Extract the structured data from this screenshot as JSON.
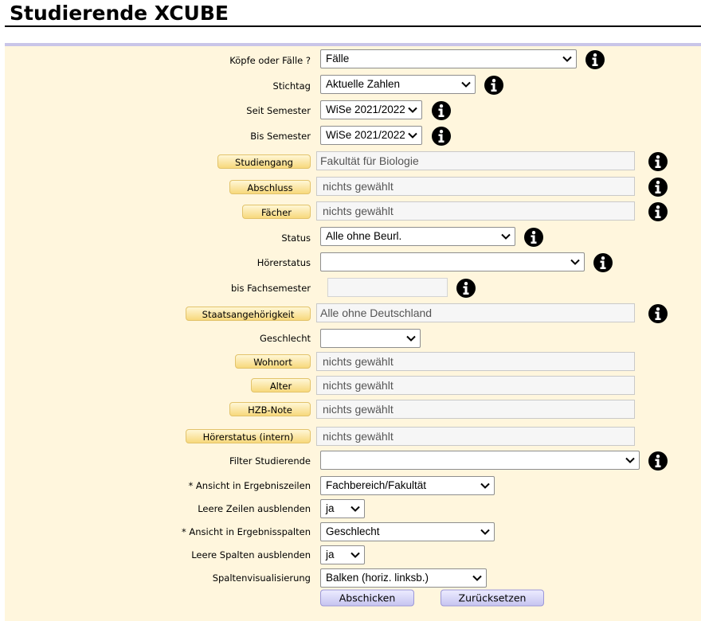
{
  "header": {
    "title": "Studierende XCUBE"
  },
  "form": {
    "koepfe": {
      "label": "Köpfe oder Fälle ?",
      "value": "Fälle"
    },
    "stichtag": {
      "label": "Stichtag",
      "value": "Aktuelle Zahlen"
    },
    "seit_semester": {
      "label": "Seit Semester",
      "value": "WiSe 2021/2022"
    },
    "bis_semester": {
      "label": "Bis Semester",
      "value": "WiSe 2021/2022"
    },
    "studiengang": {
      "button": "Studiengang",
      "value": "Fakultät für Biologie"
    },
    "abschluss": {
      "button": "Abschluss",
      "value": "nichts gewählt"
    },
    "faecher": {
      "button": "Fächer",
      "value": "nichts gewählt"
    },
    "status": {
      "label": "Status",
      "value": "Alle ohne Beurl."
    },
    "hoererstatus": {
      "label": "Hörerstatus",
      "value": ""
    },
    "bis_fachsemester": {
      "label": "bis Fachsemester",
      "value": ""
    },
    "staatsangehoerigkeit": {
      "button": "Staatsangehörigkeit",
      "value": "Alle ohne Deutschland"
    },
    "geschlecht": {
      "label": "Geschlecht",
      "value": ""
    },
    "wohnort": {
      "button": "Wohnort",
      "value": "nichts gewählt"
    },
    "alter": {
      "button": "Alter",
      "value": "nichts gewählt"
    },
    "hzb_note": {
      "button": "HZB-Note",
      "value": "nichts gewählt"
    },
    "hoererstatus_intern": {
      "button": "Hörerstatus (intern)",
      "value": "nichts gewählt"
    },
    "filter_studierende": {
      "label": "Filter Studierende",
      "value": ""
    },
    "ansicht_zeilen": {
      "label": "* Ansicht in Ergebniszeilen",
      "value": "Fachbereich/Fakultät"
    },
    "leere_zeilen": {
      "label": "Leere Zeilen ausblenden",
      "value": "ja"
    },
    "ansicht_spalten": {
      "label": "* Ansicht in Ergebnisspalten",
      "value": "Geschlecht"
    },
    "leere_spalten": {
      "label": "Leere Spalten ausblenden",
      "value": "ja"
    },
    "spaltenvisualisierung": {
      "label": "Spaltenvisualisierung",
      "value": "Balken (horiz. linksb.)"
    }
  },
  "actions": {
    "submit": "Abschicken",
    "reset": "Zurücksetzen"
  },
  "icons": {
    "info": "info-circle-icon",
    "dropdown": "chevron-down-icon"
  },
  "colors": {
    "panel_background": "#fff6dd",
    "panel_top_border": "#c9c5e8",
    "select_button_gradient_end": "#f7d87c",
    "action_button_gradient_end": "#c7c5f0"
  }
}
